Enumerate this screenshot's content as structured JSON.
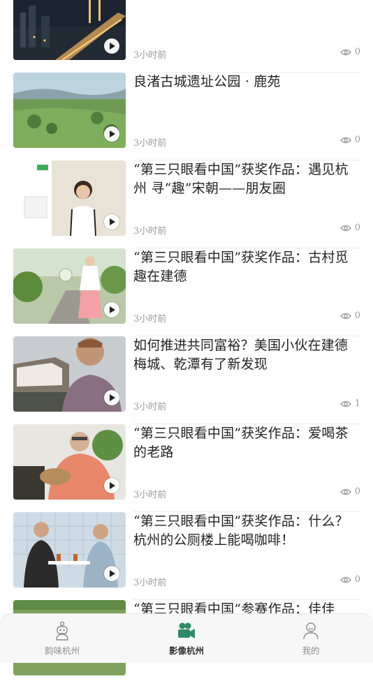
{
  "feed": {
    "items": [
      {
        "title": "",
        "time": "3小时前",
        "views": "0"
      },
      {
        "title": "良渚古城遗址公园 · 鹿苑",
        "time": "3小时前",
        "views": "0"
      },
      {
        "title": "“第三只眼看中国”获奖作品：遇见杭州 寻“趣”宋朝——朋友圈",
        "time": "3小时前",
        "views": "0"
      },
      {
        "title": "“第三只眼看中国”获奖作品：古村觅趣在建德",
        "time": "3小时前",
        "views": "0"
      },
      {
        "title": "如何推进共同富裕？美国小伙在建德梅城、乾潭有了新发现",
        "time": "3小时前",
        "views": "1"
      },
      {
        "title": "“第三只眼看中国”获奖作品：爱喝茶的老路",
        "time": "3小时前",
        "views": "0"
      },
      {
        "title": "“第三只眼看中国”获奖作品：什么？杭州的公厕楼上能喝咖啡！",
        "time": "3小时前",
        "views": "0"
      },
      {
        "title": "“第三只眼看中国”参赛作品：佳佳",
        "time": "",
        "views": ""
      }
    ]
  },
  "tabbar": {
    "tabs": [
      {
        "label": "韵味杭州",
        "icon": "robot-icon",
        "active": false
      },
      {
        "label": "影像杭州",
        "icon": "video-camera-icon",
        "active": true
      },
      {
        "label": "我的",
        "icon": "user-icon",
        "active": false
      }
    ]
  },
  "colors": {
    "accent": "#2e8b6a",
    "muted": "#9a9a9a",
    "text": "#222222"
  }
}
